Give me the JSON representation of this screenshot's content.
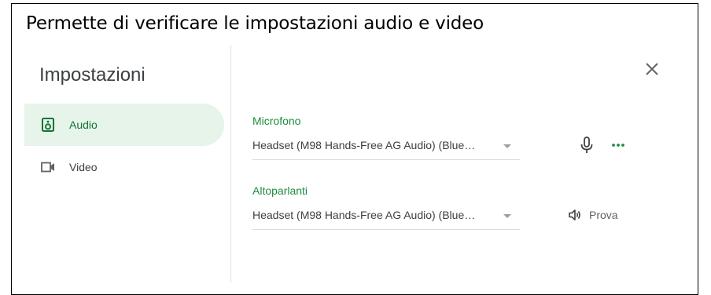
{
  "caption": "Permette di verificare le impostazioni audio e video",
  "dialog": {
    "title": "Impostazioni",
    "close_icon": "close-icon"
  },
  "nav": {
    "items": [
      {
        "label": "Audio",
        "icon": "speaker-icon",
        "active": true
      },
      {
        "label": "Video",
        "icon": "videocam-icon",
        "active": false
      }
    ]
  },
  "microphone": {
    "label": "Microfono",
    "selected": "Headset (M98 Hands-Free AG Audio) (Blue…",
    "icons": [
      "mic-icon",
      "more-icon"
    ]
  },
  "speakers": {
    "label": "Altoparlanti",
    "selected": "Headset (M98 Hands-Free AG Audio) (Blue…",
    "test_label": "Prova",
    "icon": "volume-icon"
  },
  "colors": {
    "accent": "#1e8e3e",
    "active_bg": "#e6f4ea",
    "border": "#000000"
  }
}
